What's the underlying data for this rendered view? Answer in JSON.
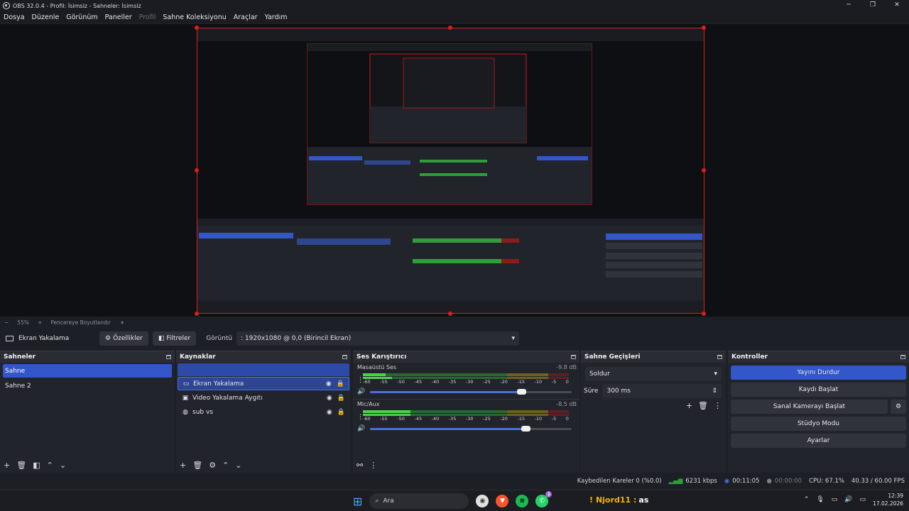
{
  "window": {
    "title": "OBS 32.0.4 - Profil: İsimsiz - Sahneler: İsimsiz"
  },
  "menu": [
    "Dosya",
    "Düzenle",
    "Görünüm",
    "Paneller",
    "Profil",
    "Sahne Koleksiyonu",
    "Araçlar",
    "Yardım"
  ],
  "zoom": {
    "minus": "−",
    "value": "55%",
    "plus": "+",
    "fit": "Pencereye Boyutlandır"
  },
  "toolbar": {
    "source_name": "Ekran Yakalama",
    "properties": "Özellikler",
    "filters": "Filtreler",
    "display_label": "Görüntü",
    "display_value": ": 1920x1080 @ 0,0 (Birincil Ekran)"
  },
  "scenes": {
    "title": "Sahneler",
    "items": [
      "Sahne",
      "Sahne 2"
    ]
  },
  "sources": {
    "title": "Kaynaklar",
    "items": [
      {
        "name": "Ekran Yakalama",
        "icon": "monitor-icon"
      },
      {
        "name": "Video Yakalama Aygıtı",
        "icon": "camera-icon"
      },
      {
        "name": "sub vs",
        "icon": "globe-icon"
      }
    ]
  },
  "mixer": {
    "title": "Ses Karıştırıcı",
    "scale": [
      "-60",
      "-55",
      "-50",
      "-45",
      "-40",
      "-35",
      "-30",
      "-25",
      "-20",
      "-15",
      "-10",
      "-5",
      "0"
    ],
    "channels": [
      {
        "name": "Masaüstü Ses",
        "db": "-9.8 dB",
        "level_top": 0.11,
        "level_bottom": 0.14,
        "volume": 0.75
      },
      {
        "name": "Mic/Aux",
        "db": "-8.5 dB",
        "level_top": 0.23,
        "level_bottom": 0.23,
        "volume": 0.77
      }
    ]
  },
  "transitions": {
    "title": "Sahne Geçişleri",
    "selected": "Soldur",
    "duration_label": "Süre",
    "duration_value": "300 ms"
  },
  "controls": {
    "title": "Kontroller",
    "buttons": [
      "Yayını Durdur",
      "Kaydı Başlat",
      "Sanal Kamerayı Başlat",
      "Stüdyo Modu",
      "Ayarlar"
    ]
  },
  "status": {
    "dropped": "Kaybedilen Kareler 0 (%0.0)",
    "bitrate": "6231 kbps",
    "stream_time": "00:11:05",
    "rec_time": "00:00:00",
    "cpu": "CPU: 67.1%",
    "fps": "40.33 / 60.00 FPS"
  },
  "taskbar": {
    "search": "Ara",
    "widget_name": "Njord11 :",
    "widget_suffix": "as",
    "time": "12:39",
    "date": "17.02.2026",
    "badge": "1"
  },
  "colors": {
    "accent": "#3356c9",
    "record_frame": "#d62024",
    "meter_green": "#2f9e3a",
    "meter_yellow": "#a8901c",
    "meter_red": "#8c1c1c"
  }
}
